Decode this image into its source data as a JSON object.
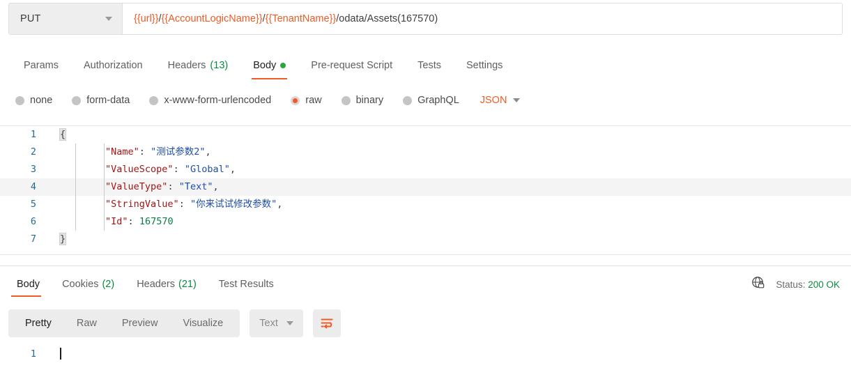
{
  "request": {
    "method": "PUT",
    "method_caret_icon": "chevron-down-icon",
    "url_segments": [
      {
        "text": "{{url}}",
        "type": "variable"
      },
      {
        "text": "/",
        "type": "plain"
      },
      {
        "text": "{{AccountLogicName}}",
        "type": "variable"
      },
      {
        "text": "/",
        "type": "plain"
      },
      {
        "text": "{{TenantName}}",
        "type": "variable"
      },
      {
        "text": "/odata/Assets(167570)",
        "type": "plain"
      }
    ],
    "url_plain": "{{url}}/{{AccountLogicName}}/{{TenantName}}/odata/Assets(167570)",
    "tabs": [
      {
        "label": "Params",
        "count": "",
        "active": false,
        "dot": false
      },
      {
        "label": "Authorization",
        "count": "",
        "active": false,
        "dot": false
      },
      {
        "label": "Headers",
        "count": "(13)",
        "active": false,
        "dot": false
      },
      {
        "label": "Body",
        "count": "",
        "active": true,
        "dot": true
      },
      {
        "label": "Pre-request Script",
        "count": "",
        "active": false,
        "dot": false
      },
      {
        "label": "Tests",
        "count": "",
        "active": false,
        "dot": false
      },
      {
        "label": "Settings",
        "count": "",
        "active": false,
        "dot": false
      }
    ],
    "body_types": [
      {
        "label": "none",
        "selected": false
      },
      {
        "label": "form-data",
        "selected": false
      },
      {
        "label": "x-www-form-urlencoded",
        "selected": false
      },
      {
        "label": "raw",
        "selected": true
      },
      {
        "label": "binary",
        "selected": false
      },
      {
        "label": "GraphQL",
        "selected": false
      }
    ],
    "format_selected": "JSON",
    "format_caret_icon": "chevron-down-icon",
    "editor": {
      "lines": [
        {
          "num": "1",
          "highlight": false,
          "guides": 0,
          "parts": [
            {
              "t": "{",
              "c": "brace"
            }
          ]
        },
        {
          "num": "2",
          "highlight": false,
          "guides": 2,
          "parts": [
            {
              "t": "        \"Name\"",
              "c": "key"
            },
            {
              "t": ": ",
              "c": "pun"
            },
            {
              "t": "\"测试参数2\"",
              "c": "str"
            },
            {
              "t": ",",
              "c": "pun"
            }
          ]
        },
        {
          "num": "3",
          "highlight": false,
          "guides": 2,
          "parts": [
            {
              "t": "        \"ValueScope\"",
              "c": "key"
            },
            {
              "t": ": ",
              "c": "pun"
            },
            {
              "t": "\"Global\"",
              "c": "str"
            },
            {
              "t": ",",
              "c": "pun"
            }
          ]
        },
        {
          "num": "4",
          "highlight": true,
          "guides": 2,
          "parts": [
            {
              "t": "        \"ValueType\"",
              "c": "key"
            },
            {
              "t": ": ",
              "c": "pun"
            },
            {
              "t": "\"Text\"",
              "c": "str"
            },
            {
              "t": ",",
              "c": "pun"
            }
          ]
        },
        {
          "num": "5",
          "highlight": false,
          "guides": 2,
          "parts": [
            {
              "t": "        \"StringValue\"",
              "c": "key"
            },
            {
              "t": ": ",
              "c": "pun"
            },
            {
              "t": "\"你来试试修改参数\"",
              "c": "str"
            },
            {
              "t": ",",
              "c": "pun"
            }
          ]
        },
        {
          "num": "6",
          "highlight": false,
          "guides": 2,
          "parts": [
            {
              "t": "        \"Id\"",
              "c": "key"
            },
            {
              "t": ": ",
              "c": "pun"
            },
            {
              "t": "167570",
              "c": "num"
            }
          ]
        },
        {
          "num": "7",
          "highlight": false,
          "guides": 0,
          "parts": [
            {
              "t": "}",
              "c": "brace"
            }
          ]
        }
      ]
    }
  },
  "response": {
    "tabs": [
      {
        "label": "Body",
        "count": "",
        "active": true
      },
      {
        "label": "Cookies",
        "count": "(2)",
        "active": false
      },
      {
        "label": "Headers",
        "count": "(21)",
        "active": false
      },
      {
        "label": "Test Results",
        "count": "",
        "active": false
      }
    ],
    "security_icon": "globe-lock-icon",
    "status_label": "Status:",
    "status_code": "200 OK",
    "view_modes": [
      {
        "label": "Pretty",
        "active": true
      },
      {
        "label": "Raw",
        "active": false
      },
      {
        "label": "Preview",
        "active": false
      },
      {
        "label": "Visualize",
        "active": false
      }
    ],
    "format_selected": "Text",
    "format_caret_icon": "chevron-down-icon",
    "wrap_icon": "word-wrap-icon",
    "body_lines": [
      {
        "num": "1",
        "text": ""
      }
    ]
  }
}
